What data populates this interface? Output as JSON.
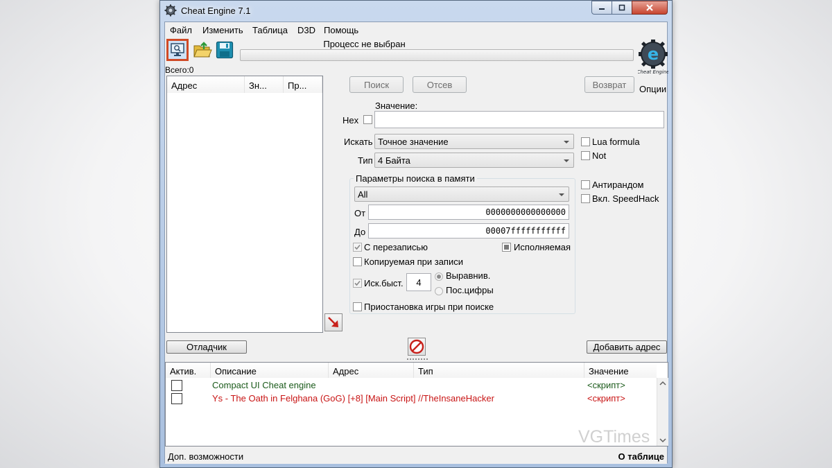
{
  "window": {
    "title": "Cheat Engine 7.1",
    "minimize_icon": "minimize-icon",
    "maximize_icon": "maximize-icon",
    "close_icon": "close-icon"
  },
  "menu": [
    "Файл",
    "Изменить",
    "Таблица",
    "D3D",
    "Помощь"
  ],
  "toolbar": {
    "process_label": "Процесс не выбран",
    "total_label": "Всего:0",
    "options_label": "Опции",
    "logo_text": "Cheat Engine",
    "icons": [
      "select-process-icon",
      "open-file-icon",
      "save-icon"
    ]
  },
  "results": {
    "columns": [
      "Адрес",
      "Зн...",
      "Пр..."
    ]
  },
  "scan": {
    "first_scan": "Поиск",
    "next_scan": "Отсев",
    "undo_scan": "Возврат",
    "value_label": "Значение:",
    "hex_label": "Hex",
    "value_input": "",
    "scan_type_label": "Искать",
    "scan_type_value": "Точное значение",
    "value_type_label": "Тип",
    "value_type_value": "4 Байта",
    "lua_formula": "Lua formula",
    "not_label": "Not",
    "unrandomizer": "Антирандом",
    "speedhack": "Вкл. SpeedHack"
  },
  "memory_options": {
    "title": "Параметры поиска в памяти",
    "region_value": "All",
    "from_label": "От",
    "from_value": "0000000000000000",
    "to_label": "До",
    "to_value": "00007fffffffffff",
    "writable": "С перезаписью",
    "executable": "Исполняемая",
    "copy_on_write": "Копируемая при записи",
    "fast_scan": "Иск.быст.",
    "fast_scan_value": "4",
    "alignment": "Выравнив.",
    "last_digits": "Пос.цифры",
    "pause_game": "Приостановка игры при поиске"
  },
  "actions": {
    "debugger": "Отладчик",
    "add_address": "Добавить адрес"
  },
  "address_list": {
    "columns": [
      "Актив.",
      "Описание",
      "Адрес",
      "Тип",
      "Значение"
    ],
    "rows": [
      {
        "description": "Compact UI Cheat engine",
        "value": "<скрипт>",
        "color": "#1a5a1a"
      },
      {
        "description": "Ys - The Oath in Felghana (GoG) [+8] [Main Script] //TheInsaneHacker",
        "value": "<скрипт>",
        "color": "#c81414"
      }
    ]
  },
  "statusbar": {
    "left": "Доп. возможности",
    "right": "О таблице"
  },
  "watermark": "VGTimes"
}
